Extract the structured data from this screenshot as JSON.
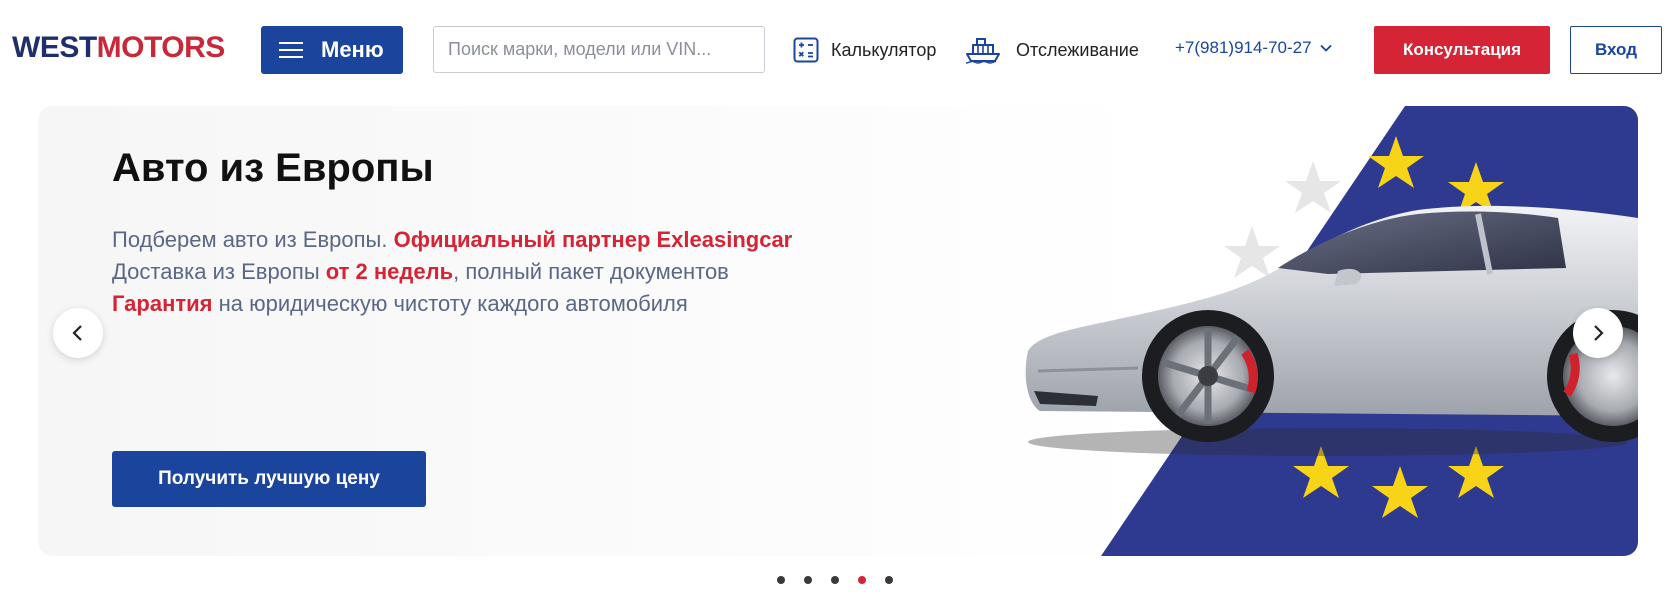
{
  "header": {
    "logo": {
      "part1": "WEST",
      "part2": "MOTORS"
    },
    "menu_label": "Меню",
    "search_placeholder": "Поиск марки, модели или VIN...",
    "calculator_label": "Калькулятор",
    "tracking_label": "Отслеживание",
    "phone": "+7(981)914-70-27",
    "consult_label": "Консультация",
    "login_label": "Вход"
  },
  "hero": {
    "title": "Авто из Европы",
    "line1_plain": "Подберем авто из Европы. ",
    "line1_highlight": "Официальный партнер Exleasingcar",
    "line2_plain_a": "Доставка из Европы ",
    "line2_highlight": "от 2 недель",
    "line2_plain_b": ", полный пакет документов",
    "line3_highlight": "Гарантия",
    "line3_plain": " на юридическую чистоту каждого автомобиля",
    "cta_label": "Получить лучшую цену"
  },
  "carousel": {
    "slides_count": 5,
    "active_index": 3
  },
  "colors": {
    "brand_blue": "#1b449c",
    "brand_red": "#d42436",
    "logo_navy": "#1f2f6e",
    "eu_blue": "#2e3a8f",
    "eu_star": "#f7d417"
  },
  "icons": [
    "menu-icon",
    "calculator-icon",
    "ship-icon",
    "chevron-down-icon",
    "chevron-left-icon",
    "chevron-right-icon"
  ]
}
